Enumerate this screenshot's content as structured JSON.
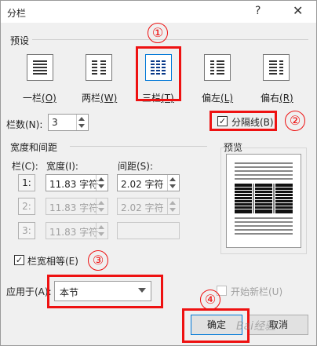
{
  "window": {
    "title": "分栏",
    "help_icon": "?",
    "close_icon": "✕"
  },
  "presets": {
    "group_label": "预设",
    "items": [
      {
        "label": "一栏(O)",
        "label_main": "一栏",
        "label_key": "(O)"
      },
      {
        "label": "两栏(W)",
        "label_main": "两栏",
        "label_key": "(W)"
      },
      {
        "label": "三栏(T)",
        "label_main": "三栏",
        "label_key": "(T)"
      },
      {
        "label": "偏左(L)",
        "label_main": "偏左",
        "label_key": "(L)"
      },
      {
        "label": "偏右(R)",
        "label_main": "偏右",
        "label_key": "(R)"
      }
    ]
  },
  "columns_count": {
    "label": "栏数(N):",
    "value": "3"
  },
  "separator": {
    "label": "分隔线(B)",
    "checked": true
  },
  "width_spacing": {
    "group_label": "宽度和间距",
    "col_header": "栏(C):",
    "width_header": "宽度(I):",
    "spacing_header": "间距(S):",
    "rows": [
      {
        "num": "1:",
        "width": "11.83 字符",
        "spacing": "2.02 字符",
        "enabled": true
      },
      {
        "num": "2:",
        "width": "11.83 字符",
        "spacing": "2.02 字符",
        "enabled": false
      },
      {
        "num": "3:",
        "width": "11.83 字符",
        "spacing": "",
        "enabled": false
      }
    ]
  },
  "equal_width": {
    "label": "栏宽相等(E)",
    "checked": true
  },
  "preview": {
    "label": "预览"
  },
  "apply_to": {
    "label": "应用于(A):",
    "value": "本节"
  },
  "new_column": {
    "label": "开始新栏(U)",
    "checked": false
  },
  "buttons": {
    "ok": "确定",
    "cancel": "取消"
  },
  "annotations": [
    "①",
    "②",
    "③",
    "④"
  ],
  "watermark": "Bai经验",
  "colors": {
    "highlight": "#ee1111",
    "accent": "#0078d7",
    "background": "#f0f0f0"
  }
}
